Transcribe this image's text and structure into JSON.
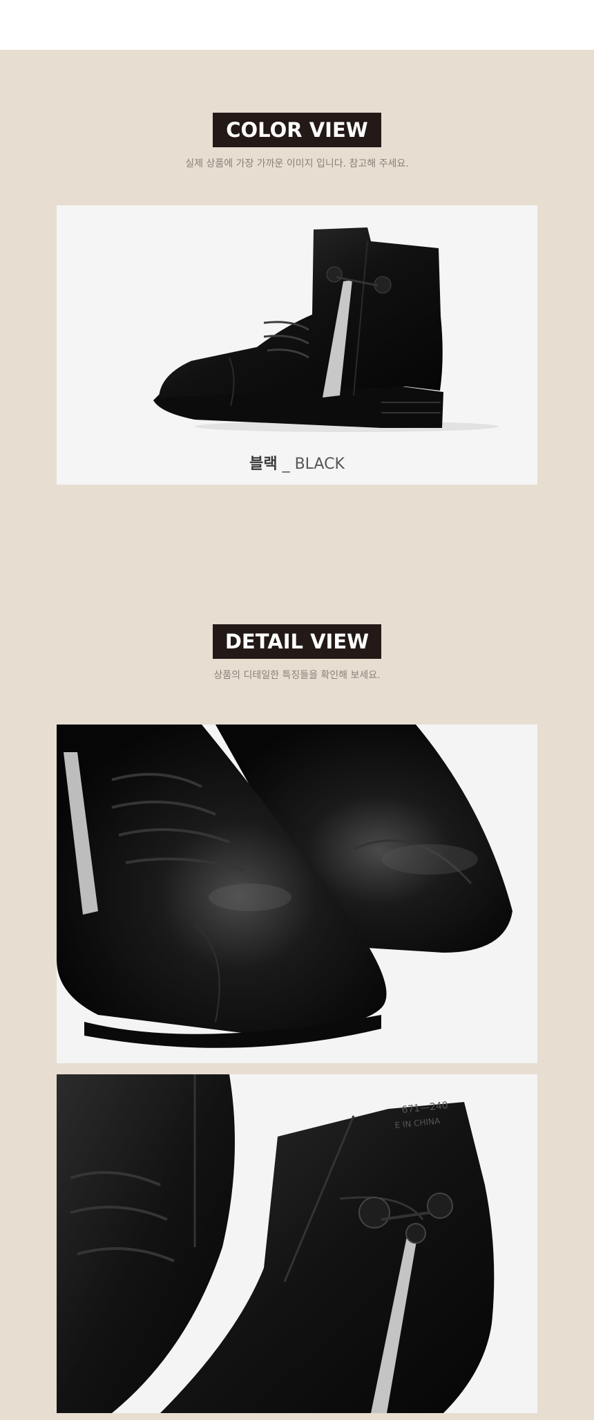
{
  "color_view": {
    "title": "COLOR VIEW",
    "subtitle": "실제 상품에 가장 가까운 이미지 입니다. 참고해 주세요.",
    "swatch": {
      "name_ko": "블랙",
      "separator": " _ ",
      "name_en": "BLACK"
    }
  },
  "detail_view": {
    "title": "DETAIL VIEW",
    "subtitle": "상품의 디테일한 특징들을 확인해 보세요.",
    "label_text": "671—240",
    "label_origin": "E IN CHINA"
  },
  "colors": {
    "background": "#e7ddd1",
    "label_bg": "#231a17",
    "photo_bg": "#f5f5f5",
    "leather": "#141414"
  }
}
